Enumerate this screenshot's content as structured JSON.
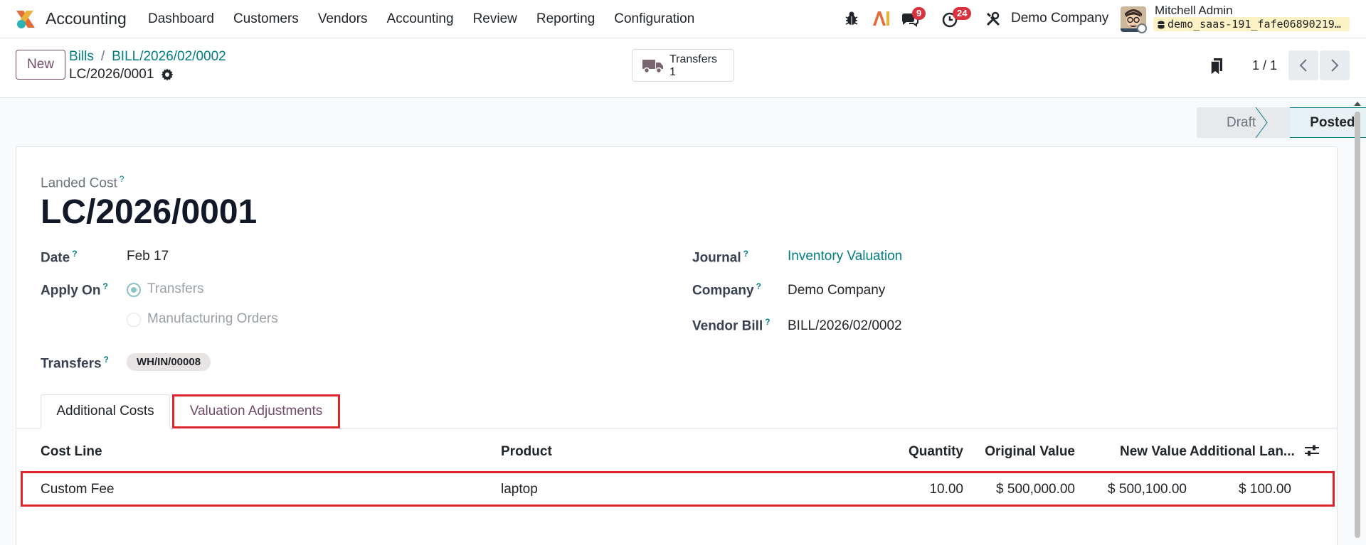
{
  "navbar": {
    "app_name": "Accounting",
    "menu": [
      "Dashboard",
      "Customers",
      "Vendors",
      "Accounting",
      "Review",
      "Reporting",
      "Configuration"
    ],
    "messages_count": "9",
    "activities_count": "24",
    "company": "Demo Company",
    "user_name": "Mitchell Admin",
    "database": "demo_saas-191_fafe06890219..."
  },
  "control": {
    "new_label": "New",
    "breadcrumb_parent": "Bills",
    "breadcrumb_bill": "BILL/2026/02/0002",
    "record_name": "LC/2026/0001",
    "smart_button_label": "Transfers",
    "smart_button_count": "1",
    "pager": "1 / 1"
  },
  "status": {
    "stages": [
      "Draft",
      "Posted"
    ],
    "current": "Posted"
  },
  "form": {
    "type_label": "Landed Cost",
    "help": "?",
    "name": "LC/2026/0001",
    "date_label": "Date",
    "date_value": "Feb 17",
    "apply_on_label": "Apply On",
    "apply_on_options": [
      "Transfers",
      "Manufacturing Orders"
    ],
    "transfers_label": "Transfers",
    "transfers_tag": "WH/IN/00008",
    "journal_label": "Journal",
    "journal_value": "Inventory Valuation",
    "company_label": "Company",
    "company_value": "Demo Company",
    "vendor_bill_label": "Vendor Bill",
    "vendor_bill_value": "BILL/2026/02/0002"
  },
  "tabs": [
    "Additional Costs",
    "Valuation Adjustments"
  ],
  "table": {
    "columns": [
      "Cost Line",
      "Product",
      "Quantity",
      "Original Value",
      "New Value",
      "Additional Lan..."
    ],
    "rows": [
      [
        "Custom Fee",
        "laptop",
        "10.00",
        "$ 500,000.00",
        "$ 500,100.00",
        "$ 100.00"
      ]
    ]
  },
  "colors": {
    "brand": "#714b67",
    "link": "#017e84",
    "highlight": "#e0242e"
  }
}
